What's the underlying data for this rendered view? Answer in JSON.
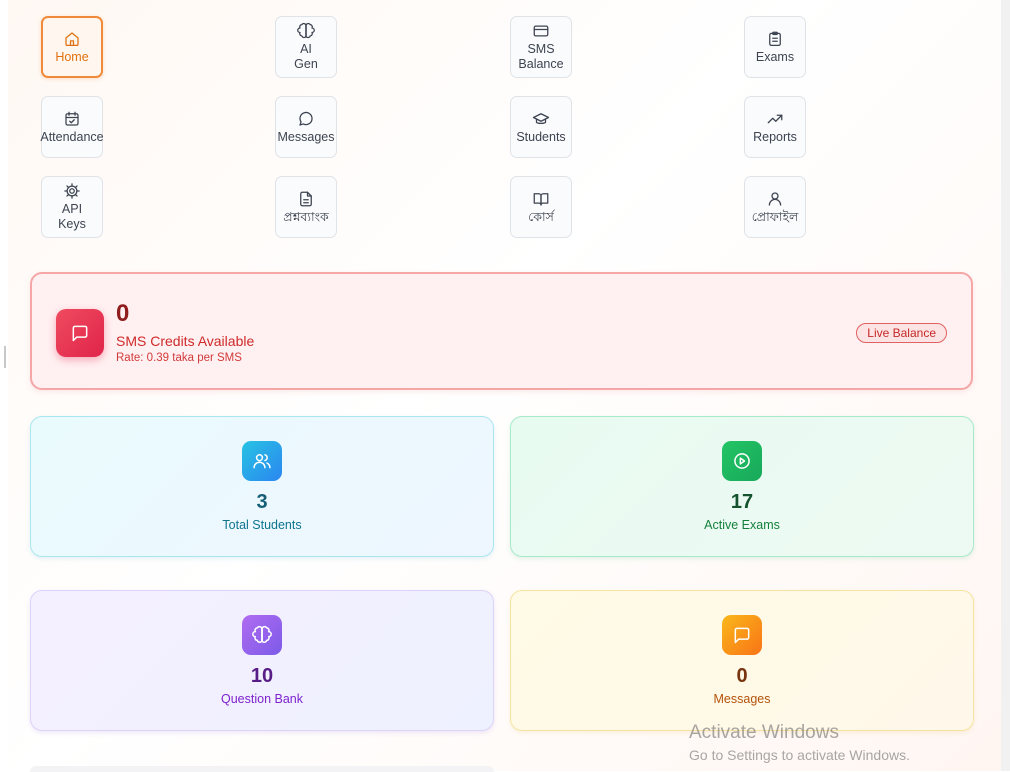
{
  "nav": [
    {
      "label": "Home",
      "icon": "home-icon"
    },
    {
      "label": "AI\nGen",
      "icon": "brain-icon"
    },
    {
      "label": "SMS\nBalance",
      "icon": "credit-card-icon"
    },
    {
      "label": "Exams",
      "icon": "clipboard-icon"
    },
    {
      "label": "Attendance",
      "icon": "calendar-check-icon"
    },
    {
      "label": "Messages",
      "icon": "message-circle-icon"
    },
    {
      "label": "Students",
      "icon": "graduation-cap-icon"
    },
    {
      "label": "Reports",
      "icon": "trending-up-icon"
    },
    {
      "label": "API\nKeys",
      "icon": "gear-icon"
    },
    {
      "label": "প্রশ্নব্যাংক",
      "icon": "file-text-icon"
    },
    {
      "label": "কোর্স",
      "icon": "book-open-icon"
    },
    {
      "label": "প্রোফাইল",
      "icon": "user-icon"
    }
  ],
  "sms": {
    "count": "0",
    "title": "SMS Credits Available",
    "rate": "Rate: 0.39 taka per SMS",
    "badge": "Live Balance",
    "icon": "message-square-icon"
  },
  "stats": {
    "students": {
      "value": "3",
      "label": "Total Students",
      "icon": "users-icon"
    },
    "exams": {
      "value": "17",
      "label": "Active Exams",
      "icon": "play-circle-icon"
    },
    "qbank": {
      "value": "10",
      "label": "Question Bank",
      "icon": "brain-icon"
    },
    "messages": {
      "value": "0",
      "label": "Messages",
      "icon": "message-square-icon"
    }
  },
  "watermark": {
    "title": "Activate Windows",
    "subtitle": "Go to Settings to activate Windows."
  },
  "colors": {
    "accent": "#f08a3a",
    "sms_red": "#e0244a",
    "students_cyan": "#2a86f0",
    "exams_green": "#17a85a",
    "qbank_purple": "#7c5ae8",
    "messages_orange": "#f97316"
  }
}
